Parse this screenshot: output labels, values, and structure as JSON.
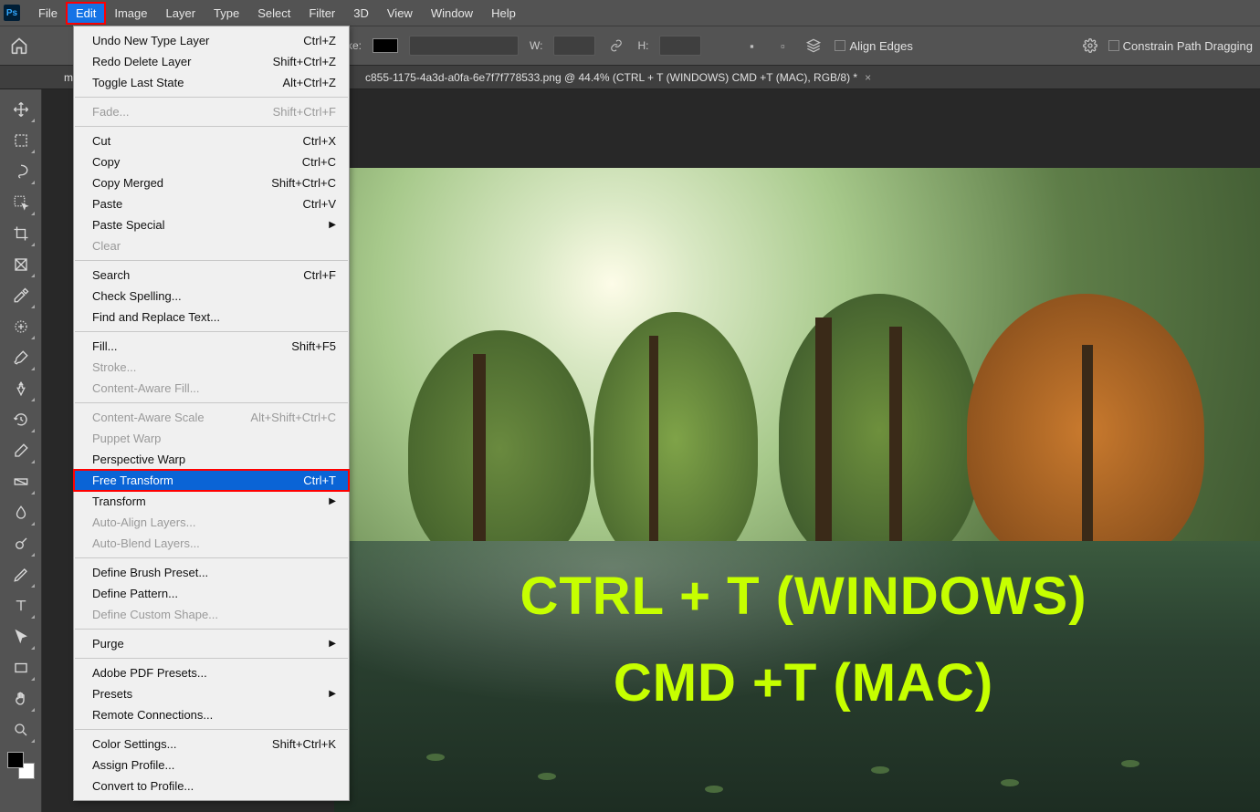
{
  "app": {
    "logo": "Ps"
  },
  "menubar": [
    "File",
    "Edit",
    "Image",
    "Layer",
    "Type",
    "Select",
    "Filter",
    "3D",
    "View",
    "Window",
    "Help"
  ],
  "activeMenuIndex": 1,
  "optionsbar": {
    "stroke_label": "Stroke:",
    "w_label": "W:",
    "h_label": "H:",
    "align_edges": "Align Edges",
    "constrain": "Constrain Path Dragging"
  },
  "document": {
    "prefix": "m",
    "tab_title": "c855-1175-4a3d-a0fa-6e7f7f778533.png @ 44.4% (CTRL + T (WINDOWS) CMD +T (MAC), RGB/8) *"
  },
  "dropdown": {
    "groups": [
      [
        {
          "label": "Undo New Type Layer",
          "shortcut": "Ctrl+Z"
        },
        {
          "label": "Redo Delete Layer",
          "shortcut": "Shift+Ctrl+Z"
        },
        {
          "label": "Toggle Last State",
          "shortcut": "Alt+Ctrl+Z"
        }
      ],
      [
        {
          "label": "Fade...",
          "shortcut": "Shift+Ctrl+F",
          "disabled": true
        }
      ],
      [
        {
          "label": "Cut",
          "shortcut": "Ctrl+X"
        },
        {
          "label": "Copy",
          "shortcut": "Ctrl+C"
        },
        {
          "label": "Copy Merged",
          "shortcut": "Shift+Ctrl+C"
        },
        {
          "label": "Paste",
          "shortcut": "Ctrl+V"
        },
        {
          "label": "Paste Special",
          "submenu": true
        },
        {
          "label": "Clear",
          "disabled": true
        }
      ],
      [
        {
          "label": "Search",
          "shortcut": "Ctrl+F"
        },
        {
          "label": "Check Spelling..."
        },
        {
          "label": "Find and Replace Text..."
        }
      ],
      [
        {
          "label": "Fill...",
          "shortcut": "Shift+F5"
        },
        {
          "label": "Stroke...",
          "disabled": true
        },
        {
          "label": "Content-Aware Fill...",
          "disabled": true
        }
      ],
      [
        {
          "label": "Content-Aware Scale",
          "shortcut": "Alt+Shift+Ctrl+C",
          "disabled": true
        },
        {
          "label": "Puppet Warp",
          "disabled": true
        },
        {
          "label": "Perspective Warp"
        },
        {
          "label": "Free Transform",
          "shortcut": "Ctrl+T",
          "selected": true
        },
        {
          "label": "Transform",
          "submenu": true
        },
        {
          "label": "Auto-Align Layers...",
          "disabled": true
        },
        {
          "label": "Auto-Blend Layers...",
          "disabled": true
        }
      ],
      [
        {
          "label": "Define Brush Preset..."
        },
        {
          "label": "Define Pattern..."
        },
        {
          "label": "Define Custom Shape...",
          "disabled": true
        }
      ],
      [
        {
          "label": "Purge",
          "submenu": true
        }
      ],
      [
        {
          "label": "Adobe PDF Presets..."
        },
        {
          "label": "Presets",
          "submenu": true
        },
        {
          "label": "Remote Connections..."
        }
      ],
      [
        {
          "label": "Color Settings...",
          "shortcut": "Shift+Ctrl+K"
        },
        {
          "label": "Assign Profile..."
        },
        {
          "label": "Convert to Profile..."
        }
      ]
    ]
  },
  "tools": [
    "move",
    "marquee",
    "lasso",
    "object-select",
    "crop",
    "frame",
    "eyedropper",
    "healing",
    "brush",
    "clone",
    "history-brush",
    "eraser",
    "gradient",
    "blur",
    "dodge",
    "pen",
    "type",
    "path-select",
    "rectangle",
    "hand",
    "zoom"
  ],
  "overlay": {
    "line1": "CTRL + T (WINDOWS)",
    "line2": "CMD +T (MAC)"
  }
}
